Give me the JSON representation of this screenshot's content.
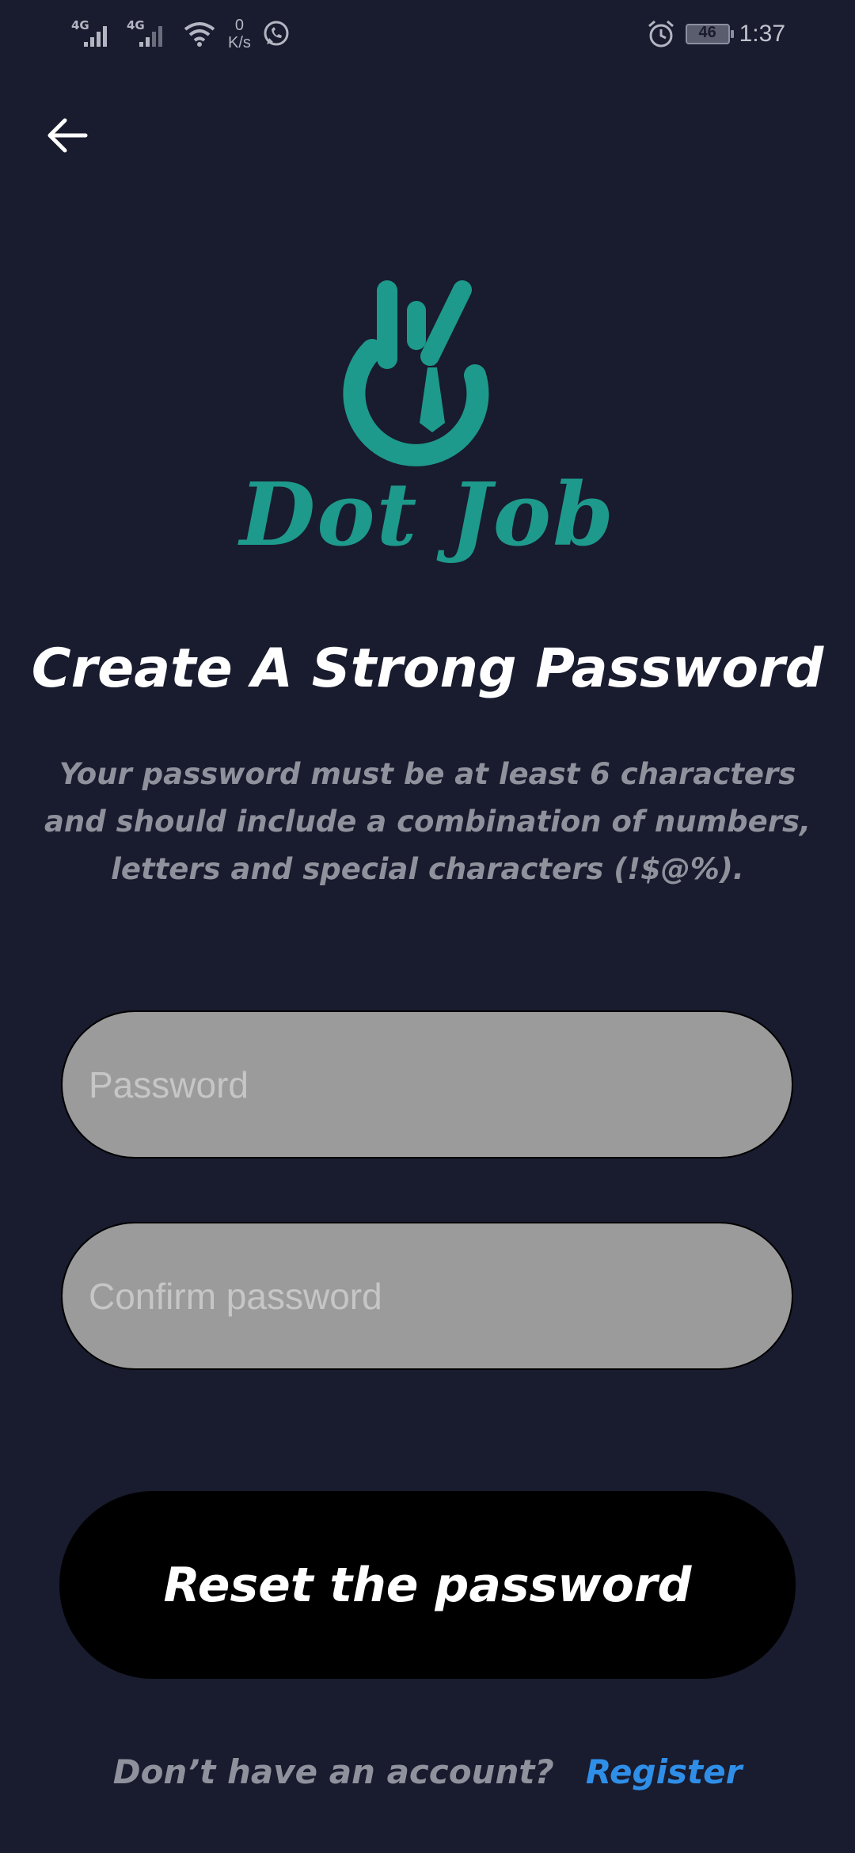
{
  "status_bar": {
    "network_1": "4G",
    "network_2": "4G",
    "speed_value": "0",
    "speed_unit": "K/s",
    "battery": "46",
    "time": "1:37"
  },
  "icons": {
    "back": "arrow-left-icon",
    "alarm": "alarm-icon",
    "wifi": "wifi-icon",
    "whatsapp": "whatsapp-icon"
  },
  "brand": {
    "name": "Dot Job",
    "color": "#1d9a8c"
  },
  "page": {
    "title": "Create A Strong Password",
    "subtitle": "Your password must be at least 6 characters and should include a combination of numbers, letters and special characters (!$@%)."
  },
  "form": {
    "password_placeholder": "Password",
    "password_value": "",
    "confirm_placeholder": "Confirm password",
    "confirm_value": "",
    "submit_label": "Reset the password"
  },
  "footer": {
    "question": "Don’t have an account?",
    "link_label": "Register",
    "link_color": "#2f8fe8"
  },
  "colors": {
    "background": "#191b2e",
    "field_background": "#9b9b9b",
    "button_background": "#000000"
  }
}
